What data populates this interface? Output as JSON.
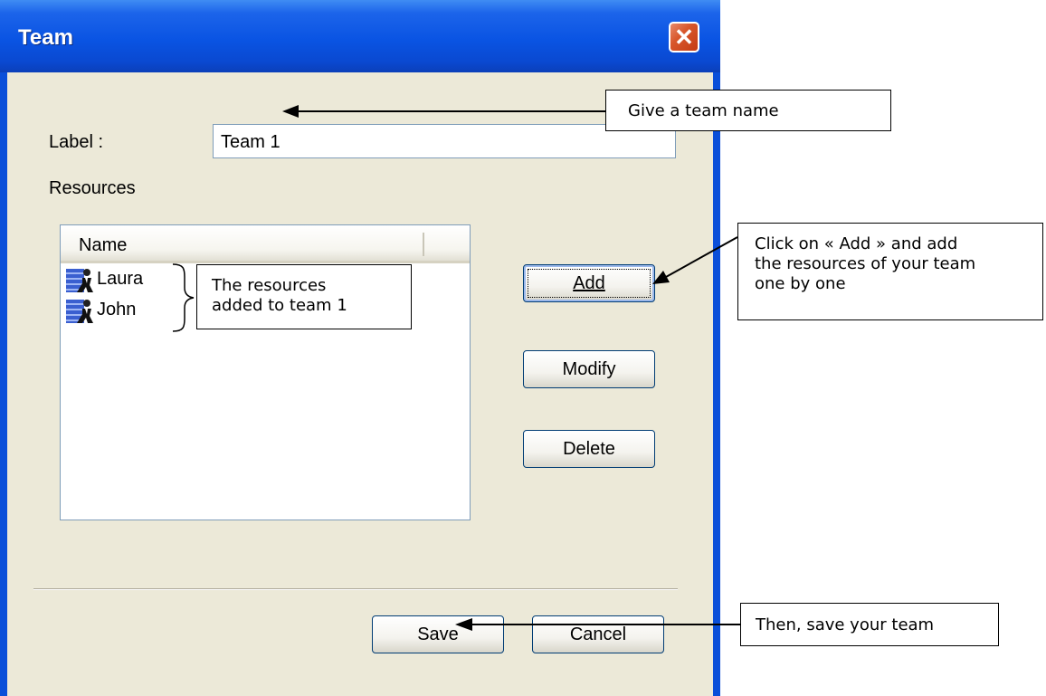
{
  "window": {
    "title": "Team",
    "close_symbol": "✕"
  },
  "form": {
    "label_caption": "Label :",
    "label_value": "Team 1",
    "resources_caption": "Resources"
  },
  "list": {
    "column_header": "Name",
    "items": [
      {
        "name": "Laura",
        "icon": "person-icon"
      },
      {
        "name": "John",
        "icon": "person-icon"
      }
    ]
  },
  "buttons": {
    "add": "Add",
    "modify": "Modify",
    "delete": "Delete",
    "save": "Save",
    "cancel": "Cancel"
  },
  "callouts": {
    "team_name": "Give a team name",
    "add_line1": "Click  on  « Add »  and  add",
    "add_line2": "the resources of your team",
    "add_line3": "one by one",
    "resources_line1": "The resources",
    "resources_line2": "added to team 1",
    "save": "Then, save your team"
  },
  "colors": {
    "titlebar": "#0a54e3",
    "client": "#ece9d8",
    "close_button": "#d8572c"
  }
}
